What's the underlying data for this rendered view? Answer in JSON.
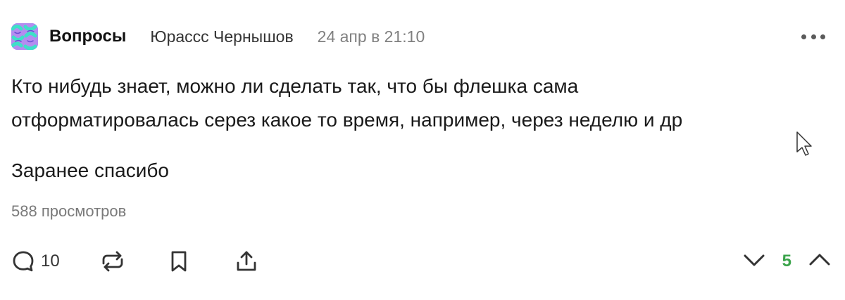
{
  "post": {
    "community": "Вопросы",
    "author": "Юрассс Чернышов",
    "time": "24 апр в 21:10",
    "text_lines": [
      "Кто нибудь знает, можно ли сделать так, что бы флешка сама",
      "отформатировалась серез какое то время, например, через неделю и др"
    ],
    "text_extra": "Заранее спасибо",
    "views": "588 просмотров"
  },
  "actions": {
    "comments_count": "10",
    "rating": "5"
  },
  "colors": {
    "rating": "#3aa34a",
    "avatar_bg": "#b48cf0",
    "avatar_pattern": "#3ee0c8"
  },
  "icons": {
    "avatar": "community-avatar-pattern",
    "more": "more-dots-icon",
    "comment": "comment-bubble-icon",
    "repost": "repost-icon",
    "bookmark": "bookmark-icon",
    "share": "share-icon",
    "vote_down": "chevron-down-icon",
    "vote_up": "chevron-up-icon",
    "cursor": "mouse-cursor-icon"
  }
}
